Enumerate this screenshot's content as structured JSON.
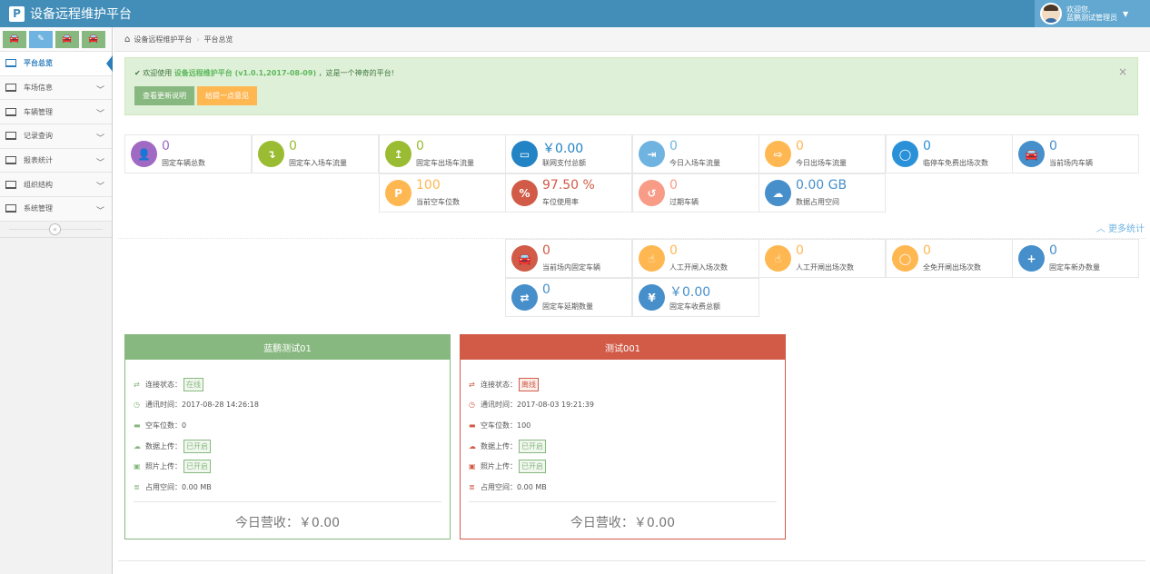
{
  "app": {
    "title": "设备远程维护平台",
    "logo": "P"
  },
  "user": {
    "greeting": "欢迎您,",
    "name": "蓝鹏测试管理员"
  },
  "colors": {
    "navbar": "#438eb9",
    "active": "#2b7dbc",
    "green": "#87b87f",
    "red": "#d15b47",
    "orange": "#ffb752"
  },
  "sidebar": {
    "shortcuts": [
      {
        "icon": "car-icon",
        "glyph": "🚘"
      },
      {
        "icon": "pencil-icon",
        "glyph": "✎"
      },
      {
        "icon": "car-icon",
        "glyph": "🚘"
      },
      {
        "icon": "car-icon",
        "glyph": "🚘"
      }
    ],
    "items": [
      {
        "label": "平台总览",
        "active": true
      },
      {
        "label": "车场信息"
      },
      {
        "label": "车辆管理"
      },
      {
        "label": "记录查询"
      },
      {
        "label": "报表统计"
      },
      {
        "label": "组织结构"
      },
      {
        "label": "系统管理"
      }
    ],
    "collapse_glyph": "«"
  },
  "breadcrumb": {
    "home": "设备远程维护平台",
    "current": "平台总览"
  },
  "alert": {
    "prefix": "欢迎使用",
    "highlight": "设备远程维护平台 (v1.0.1,2017-08-09)",
    "suffix": "，这是一个神奇的平台!",
    "close": "×",
    "btn_changelog": "查看更新说明",
    "btn_feedback": "给提一点意见"
  },
  "stats": [
    {
      "value": "0",
      "label": "固定车辆总数",
      "color": "#a069c3",
      "glyph": "👤",
      "icon": "user-icon"
    },
    {
      "value": "0",
      "label": "固定车入场车流量",
      "color": "#9abc32",
      "glyph": "↴",
      "icon": "enter-arrow-icon"
    },
    {
      "value": "0",
      "label": "固定车出场车流量",
      "color": "#9abc32",
      "glyph": "↥",
      "icon": "exit-arrow-icon"
    },
    {
      "value": "￥0.00",
      "label": "联网支付总额",
      "color": "#2283c5",
      "glyph": "▭",
      "icon": "credit-card-icon"
    },
    {
      "value": "0",
      "label": "今日入场车流量",
      "color": "#6fb3e0",
      "glyph": "⇥",
      "icon": "sign-in-icon"
    },
    {
      "value": "0",
      "label": "今日出场车流量",
      "color": "#ffb752",
      "glyph": "⇨",
      "icon": "sign-out-icon"
    },
    {
      "value": "0",
      "label": "临停车免费出场次数",
      "color": "#2a91d8",
      "glyph": "◯",
      "icon": "circle-icon"
    },
    {
      "value": "0",
      "label": "当前场内车辆",
      "color": "#478fca",
      "glyph": "🚘",
      "icon": "car-icon"
    },
    {
      "value": "100",
      "label": "当前空车位数",
      "color": "#ffb752",
      "glyph": "P",
      "icon": "parking-icon"
    },
    {
      "value": "97.50 %",
      "label": "车位使用率",
      "color": "#d15b47",
      "glyph": "%",
      "icon": "percent-icon"
    },
    {
      "value": "0",
      "label": "过期车辆",
      "color": "#f89c87",
      "glyph": "↺",
      "icon": "clock-icon"
    },
    {
      "value": "0.00 GB",
      "label": "数据占用空间",
      "color": "#478fca",
      "glyph": "☁",
      "icon": "cloud-icon"
    },
    {
      "value": "0",
      "label": "当前场内固定车辆",
      "color": "#d15b47",
      "glyph": "🚘",
      "icon": "car-icon"
    },
    {
      "value": "0",
      "label": "人工开闸入场次数",
      "color": "#ffb752",
      "glyph": "☝",
      "icon": "hand-pointer-icon"
    },
    {
      "value": "0",
      "label": "人工开闸出场次数",
      "color": "#ffb752",
      "glyph": "☝",
      "icon": "hand-pointer-icon"
    },
    {
      "value": "0",
      "label": "全免开闸出场次数",
      "color": "#ffb752",
      "glyph": "◯",
      "icon": "circle-icon"
    },
    {
      "value": "0",
      "label": "固定车新办数量",
      "color": "#478fca",
      "glyph": "+",
      "icon": "plus-icon"
    },
    {
      "value": "0",
      "label": "固定车延期数量",
      "color": "#478fca",
      "glyph": "⇄",
      "icon": "retweet-icon"
    },
    {
      "value": "￥0.00",
      "label": "固定车收费总额",
      "color": "#478fca",
      "glyph": "¥",
      "icon": "yen-icon"
    }
  ],
  "more_stats": "更多统计",
  "stations": [
    {
      "name": "蓝鹏测试01",
      "status": "在线",
      "last_comm": "2017-08-28 14:26:18",
      "empty_spaces": "0",
      "data_upload": "已开启",
      "photo_upload": "已开启",
      "storage": "0.00 MB",
      "revenue": "今日营收：￥0.00"
    },
    {
      "name": "测试001",
      "status": "离线",
      "last_comm": "2017-08-03 19:21:39",
      "empty_spaces": "100",
      "data_upload": "已开启",
      "photo_upload": "已开启",
      "storage": "0.00 MB",
      "revenue": "今日营收：￥0.00"
    }
  ],
  "station_labels": {
    "status": "连接状态：",
    "last_comm": "通讯时间：",
    "empty_spaces": "空车位数：",
    "data_upload": "数据上传：",
    "photo_upload": "照片上传：",
    "storage": "占用空间："
  }
}
